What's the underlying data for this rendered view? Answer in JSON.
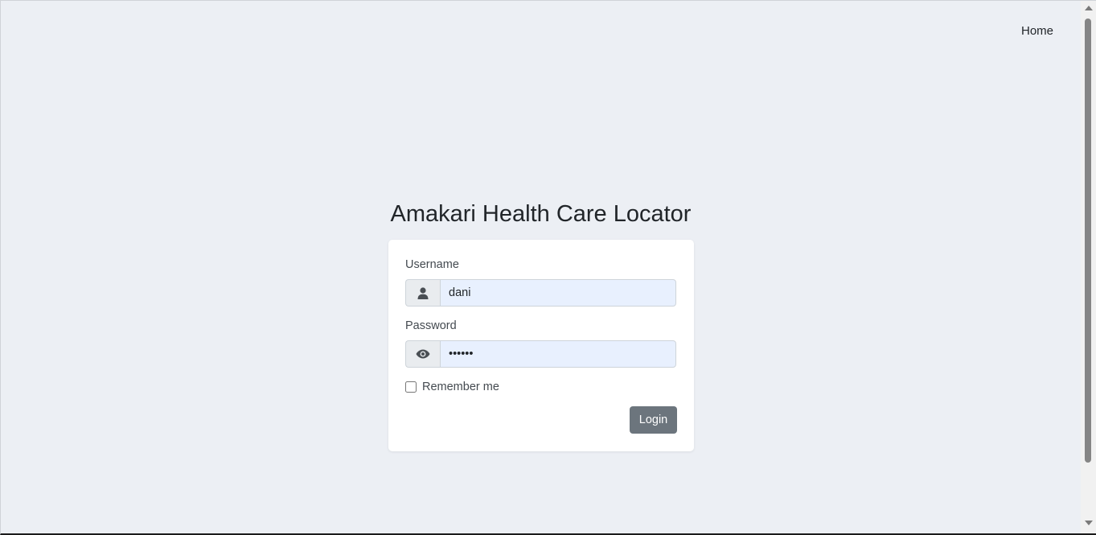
{
  "nav": {
    "home_label": "Home"
  },
  "page": {
    "title": "Amakari Health Care Locator"
  },
  "login_form": {
    "username_label": "Username",
    "username_value": "dani",
    "username_icon": "user-icon",
    "password_label": "Password",
    "password_value": "dani12",
    "password_icon": "eye-icon",
    "remember_label": "Remember me",
    "remember_checked": false,
    "login_button_label": "Login"
  },
  "colors": {
    "background": "#eceff4",
    "button": "#6c757d",
    "input_autofill": "#e8f0fe"
  }
}
